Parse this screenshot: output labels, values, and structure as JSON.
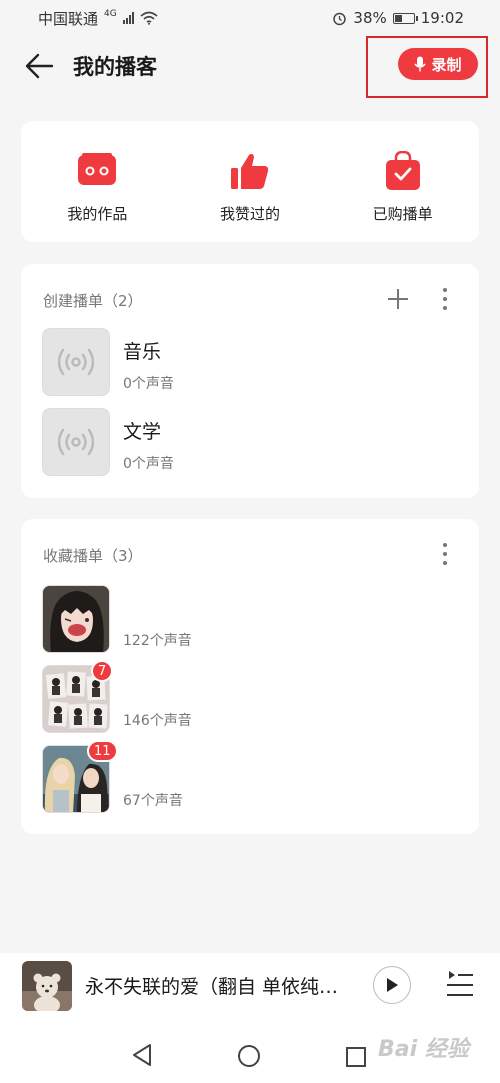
{
  "status_bar": {
    "carrier": "中国联通",
    "network": "4G",
    "battery": "38%",
    "time": "19:02"
  },
  "header": {
    "title": "我的播客",
    "record_label": "录制",
    "back_icon": "arrow-left-icon"
  },
  "quick_actions": [
    {
      "label": "我的作品",
      "icon": "radio-icon"
    },
    {
      "label": "我赞过的",
      "icon": "thumbs-up-icon"
    },
    {
      "label": "已购播单",
      "icon": "shopping-bag-check-icon"
    }
  ],
  "created_section": {
    "title": "创建播单（2）",
    "items": [
      {
        "title": "音乐",
        "subtitle": "0个声音"
      },
      {
        "title": "文学",
        "subtitle": "0个声音"
      }
    ]
  },
  "collected_section": {
    "title": "收藏播单（3）",
    "items": [
      {
        "title": "",
        "subtitle": "122个声音",
        "badge": ""
      },
      {
        "title": "",
        "subtitle": "146个声音",
        "badge": "7"
      },
      {
        "title": "",
        "subtitle": "67个声音",
        "badge": "11"
      }
    ]
  },
  "player": {
    "title": "永不失联的爱（翻自 单依纯…"
  },
  "watermark": "Bai 经验",
  "colors": {
    "accent": "#ef3b3f",
    "highlight_box": "#d42a2a",
    "background": "#f5f5f5"
  }
}
